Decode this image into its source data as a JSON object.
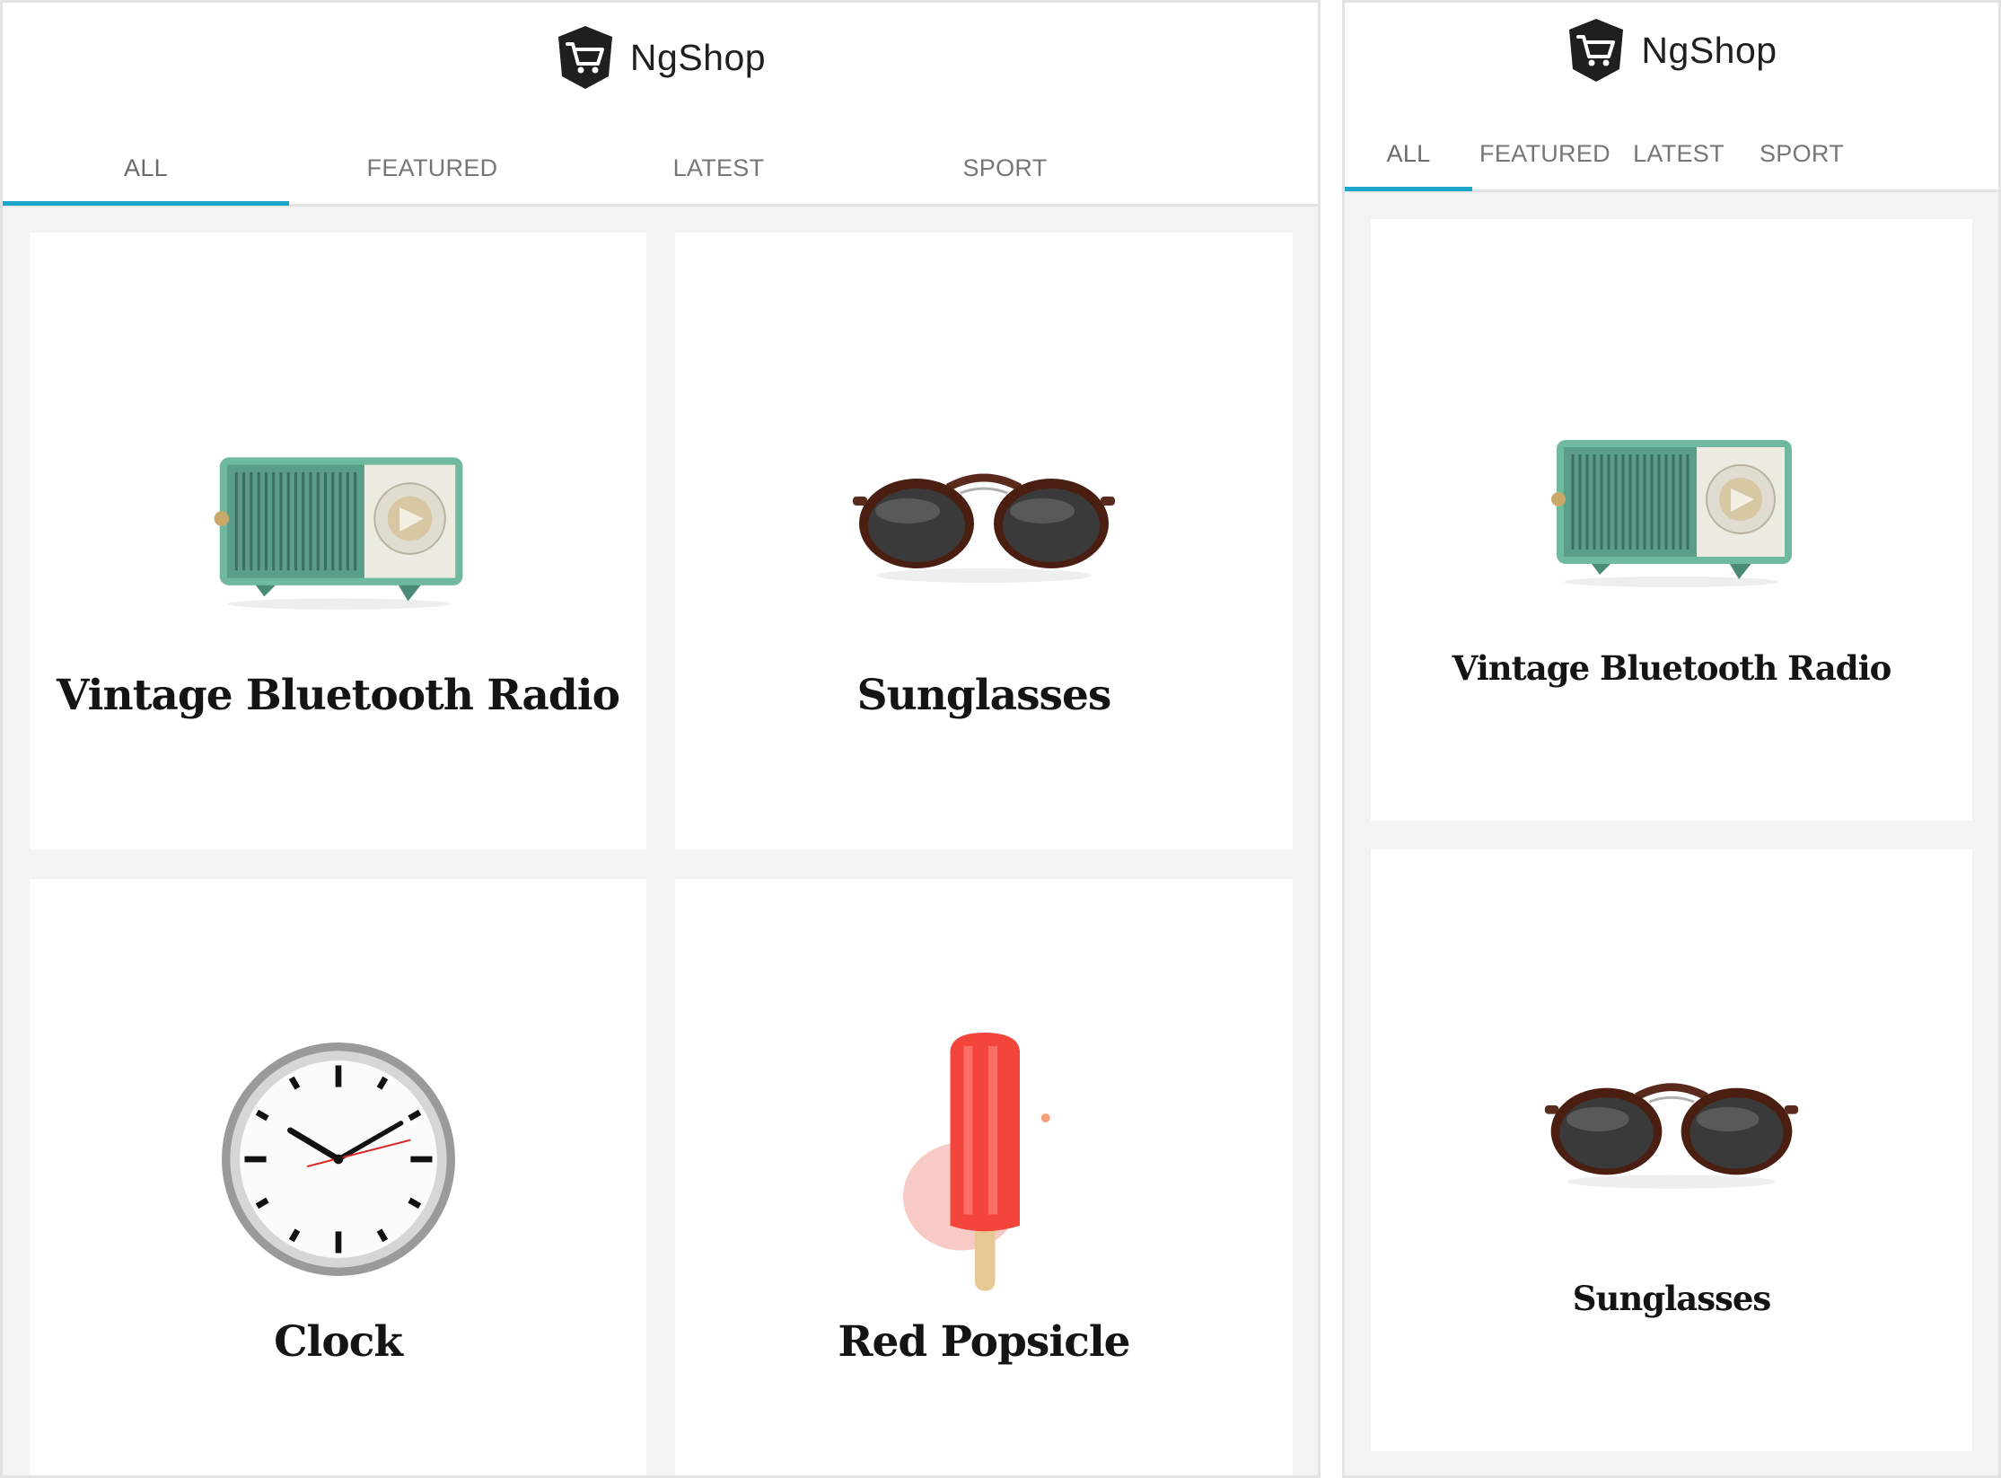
{
  "app": {
    "brand_name": "NgShop",
    "accent_color": "#1ba6cc"
  },
  "tabs": [
    {
      "label": "ALL",
      "active": true
    },
    {
      "label": "FEATURED",
      "active": false
    },
    {
      "label": "LATEST",
      "active": false
    },
    {
      "label": "SPORT",
      "active": false
    }
  ],
  "products": [
    {
      "title": "Vintage Bluetooth Radio",
      "image": "radio-image"
    },
    {
      "title": "Sunglasses",
      "image": "sunglasses-image"
    },
    {
      "title": "Clock",
      "image": "clock-image"
    },
    {
      "title": "Red Popsicle",
      "image": "popsicle-image"
    }
  ]
}
